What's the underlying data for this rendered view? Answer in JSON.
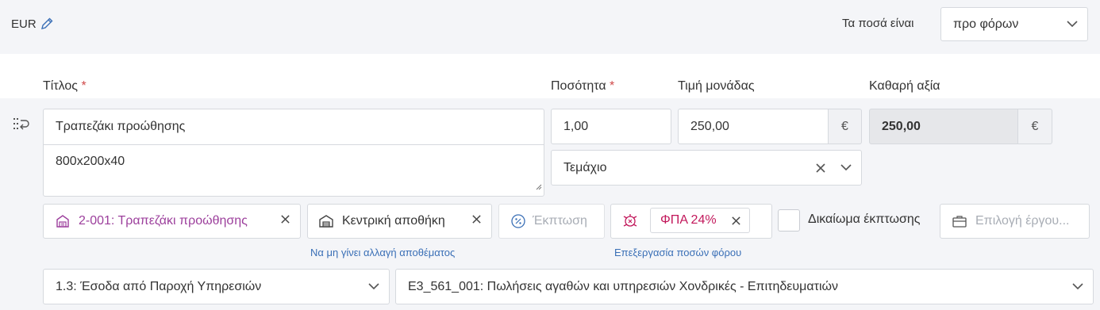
{
  "header": {
    "currency": "EUR",
    "amounts_label": "Τα ποσά είναι",
    "amounts_select": "προ φόρων"
  },
  "labels": {
    "title": "Τίτλος",
    "quantity": "Ποσότητα",
    "unit_price": "Τιμή μονάδας",
    "net_value": "Καθαρή αξία",
    "required_mark": "*"
  },
  "line": {
    "title_value": "Τραπεζάκι προώθησης",
    "description_value": "800x200x40",
    "quantity_value": "1,00",
    "unit_price_value": "250,00",
    "unit_price_suffix": "€",
    "net_value": "250,00",
    "net_value_suffix": "€",
    "unit_select": "Τεμάχιο"
  },
  "chips": {
    "product": "2-001: Τραπεζάκι προώθησης",
    "warehouse": "Κεντρική αποθήκη",
    "discount": "Έκπτωση",
    "vat": "ΦΠΑ 24%",
    "discount_right_label": "Δικαίωμα έκπτωσης",
    "project_placeholder": "Επιλογή έργου..."
  },
  "hints": {
    "no_stock_change": "Να μη γίνει αλλαγή αποθέματος",
    "edit_tax_amounts": "Επεξεργασία ποσών φόρου"
  },
  "classification": {
    "category": "1.3: Έσοδα από Παροχή Υπηρεσιών",
    "type": "E3_561_001: Πωλήσεις αγαθών και υπηρεσιών Χονδρικές - Επιτηδευματιών"
  },
  "colors": {
    "accent_product": "#9c3f9c",
    "accent_vat": "#c2185b",
    "link": "#3a6fb6",
    "required": "#d04a4a",
    "panel_bg": "#f4f5f8"
  }
}
